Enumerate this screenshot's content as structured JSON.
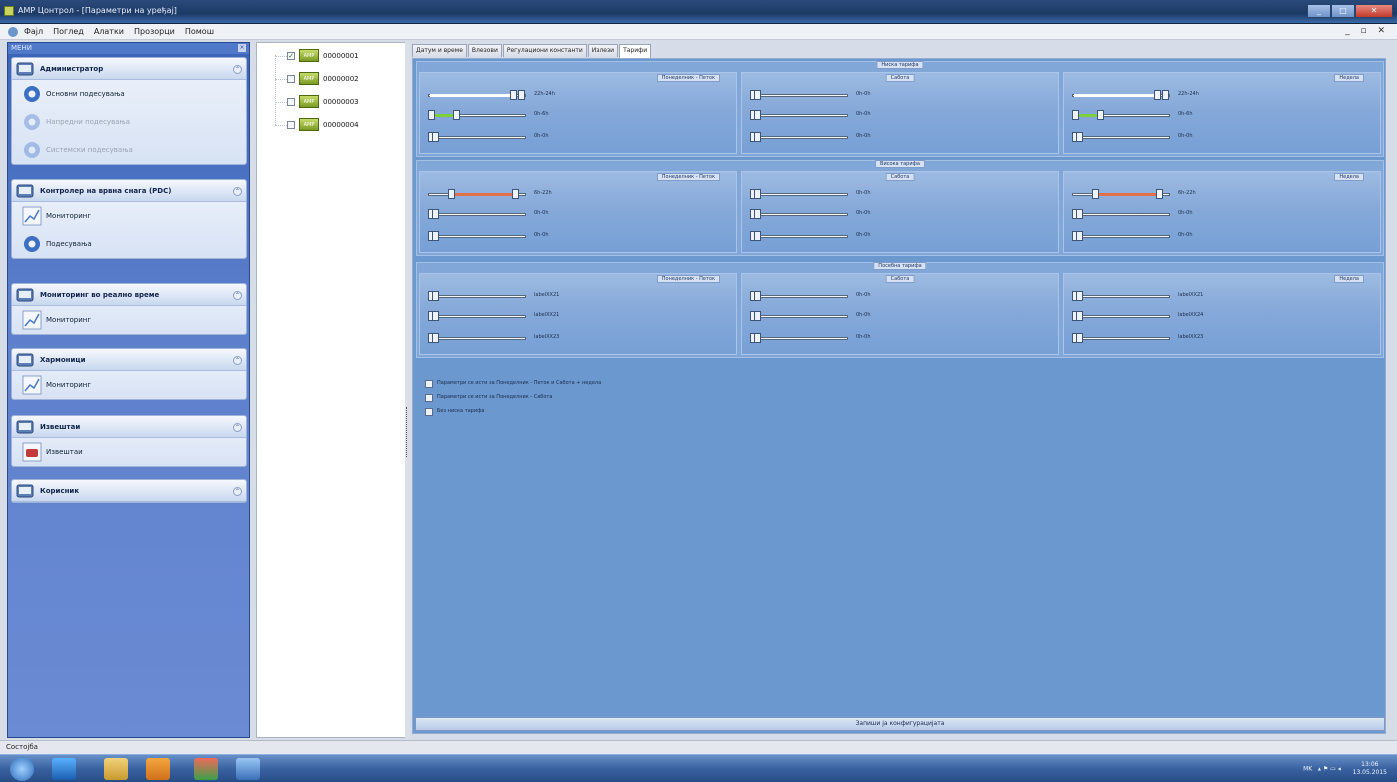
{
  "window": {
    "title": "AMP Цонтрол - [Параметри на уређај]",
    "controls": [
      "_",
      "□",
      "✕"
    ]
  },
  "menubar": {
    "items": [
      "Фајл",
      "Поглед",
      "Алатки",
      "Прозорци",
      "Помош"
    ],
    "mdi_controls": "_ ▫ ✕"
  },
  "sidebar": {
    "header": "МЕНИ",
    "close": "×",
    "groups": [
      {
        "title": "Администратор",
        "collapse": "⌃",
        "items": [
          {
            "label": "Основни подесувања",
            "enabled": true,
            "icon": "gear-icon"
          },
          {
            "label": "Напредни подесувања",
            "enabled": false,
            "icon": "gear-icon"
          },
          {
            "label": "Системски подесувања",
            "enabled": false,
            "icon": "gear-icon"
          }
        ]
      },
      {
        "title": "Контролер на врвна снага (PDC)",
        "collapse": "⌃",
        "items": [
          {
            "label": "Мониторинг",
            "enabled": true,
            "icon": "chart-icon"
          },
          {
            "label": "Подесувања",
            "enabled": true,
            "icon": "gear-icon"
          }
        ]
      },
      {
        "title": "Мониторинг во реално време",
        "collapse": "⌃",
        "items": [
          {
            "label": "Мониторинг",
            "enabled": true,
            "icon": "chart-icon"
          }
        ]
      },
      {
        "title": "Хармоници",
        "collapse": "⌃",
        "items": [
          {
            "label": "Мониторинг",
            "enabled": true,
            "icon": "chart-icon"
          }
        ]
      },
      {
        "title": "Извештаи",
        "collapse": "⌃",
        "items": [
          {
            "label": "Извештаи",
            "enabled": true,
            "icon": "report-icon"
          }
        ]
      },
      {
        "title": "Корисник",
        "collapse": "⌃",
        "items": []
      }
    ]
  },
  "tree": {
    "nodes": [
      {
        "label": "00000001",
        "checked": true,
        "icon_text": "AMP"
      },
      {
        "label": "00000002",
        "checked": false,
        "icon_text": "AMP"
      },
      {
        "label": "00000003",
        "checked": false,
        "icon_text": "AMP"
      },
      {
        "label": "00000004",
        "checked": false,
        "icon_text": "AMP"
      }
    ]
  },
  "tabs": [
    "Датум и време",
    "Влезови",
    "Регулациони константи",
    "Излези",
    "Тарифи"
  ],
  "active_tab": 4,
  "sections": [
    {
      "title": "Ниска тарифа",
      "panels": [
        {
          "title": "Понеделник - Петок",
          "sliders": [
            {
              "label": "22h-24h",
              "kind": "range-end",
              "fill_color": "#ffffff"
            },
            {
              "label": "0h-6h",
              "kind": "fill",
              "value": 0.3,
              "fill_color": "#7ccf3a"
            },
            {
              "label": "0h-0h",
              "kind": "empty"
            }
          ]
        },
        {
          "title": "Сабота",
          "sliders": [
            {
              "label": "0h-0h",
              "kind": "empty"
            },
            {
              "label": "0h-0h",
              "kind": "empty"
            },
            {
              "label": "0h-0h",
              "kind": "empty"
            }
          ]
        },
        {
          "title": "Недела",
          "sliders": [
            {
              "label": "22h-24h",
              "kind": "range-end",
              "fill_color": "#ffffff"
            },
            {
              "label": "0h-6h",
              "kind": "fill",
              "value": 0.3,
              "fill_color": "#7ccf3a"
            },
            {
              "label": "0h-0h",
              "kind": "empty"
            }
          ]
        }
      ]
    },
    {
      "title": "Висока тарифа",
      "panels": [
        {
          "title": "Понеделник - Петок",
          "sliders": [
            {
              "label": "6h-22h",
              "kind": "range-mid",
              "fill_color": "#e2704a"
            },
            {
              "label": "0h-0h",
              "kind": "empty"
            },
            {
              "label": "0h-0h",
              "kind": "empty"
            }
          ]
        },
        {
          "title": "Сабота",
          "sliders": [
            {
              "label": "0h-0h",
              "kind": "empty"
            },
            {
              "label": "0h-0h",
              "kind": "empty"
            },
            {
              "label": "0h-0h",
              "kind": "empty"
            }
          ]
        },
        {
          "title": "Недела",
          "sliders": [
            {
              "label": "6h-22h",
              "kind": "range-mid",
              "fill_color": "#e2704a"
            },
            {
              "label": "0h-0h",
              "kind": "empty"
            },
            {
              "label": "0h-0h",
              "kind": "empty"
            }
          ]
        }
      ]
    },
    {
      "title": "Посебна тарифа",
      "panels": [
        {
          "title": "Понеделник - Петок",
          "sliders": [
            {
              "label": "labelXX21",
              "kind": "empty"
            },
            {
              "label": "labelXX21",
              "kind": "empty"
            },
            {
              "label": "labelXX23",
              "kind": "empty"
            }
          ]
        },
        {
          "title": "Сабота",
          "sliders": [
            {
              "label": "0h-0h",
              "kind": "empty"
            },
            {
              "label": "0h-0h",
              "kind": "empty"
            },
            {
              "label": "0h-0h",
              "kind": "empty"
            }
          ]
        },
        {
          "title": "Недела",
          "sliders": [
            {
              "label": "labelXX21",
              "kind": "empty"
            },
            {
              "label": "labelXX24",
              "kind": "empty"
            },
            {
              "label": "labelXX23",
              "kind": "empty"
            }
          ]
        }
      ]
    }
  ],
  "options": [
    "Параметри се исти за Понеделник - Петок и Сабота + недела",
    "Параметри се исти за Понеделник - Сабота",
    "Без ниска тарифа"
  ],
  "save_button": "Запиши ја конфигурацијата",
  "statusbar": "Состојба",
  "taskbar": {
    "icons": [
      "windows-start-icon",
      "internet-explorer-icon",
      "file-explorer-icon",
      "media-player-icon",
      "paint-icon",
      "amp-app-icon"
    ],
    "tray_lang": "MK",
    "tray_icons": "▴ ⚑ ▭ ◂",
    "time": "13:06",
    "date": "13.05.2015"
  },
  "colors": {
    "content_bg": "#6b98ce",
    "sidebar_bg": "#5d80cc",
    "low_tariff_fill": "#7ccf3a",
    "high_tariff_fill": "#e2704a"
  }
}
